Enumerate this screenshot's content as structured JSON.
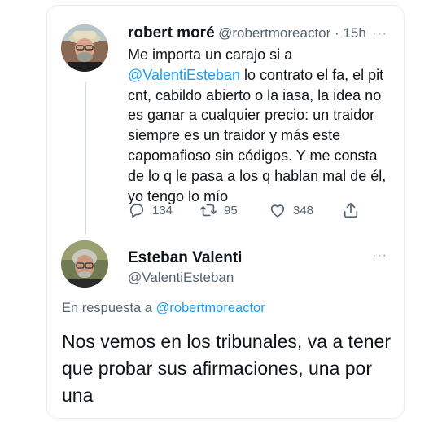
{
  "tweet1": {
    "name": "robert moré",
    "handle": "@robertmoreactor",
    "separator": " · ",
    "time": "15h",
    "text_before": "Me importa un carajo si a ",
    "mention": "@ValentiEsteban",
    "text_after": " lo contrato el fa, el pit cnt, cabildo abierto o la iasa, la idea no es ganar a cualquier precio: un traidor siempre es un traidor y más este capomafioso sin códigos. Y me consta de lo q le pasa a los q hablan mal de él, yo tengo lo mío",
    "replies": "134",
    "retweets": "95",
    "likes": "348",
    "more": "···"
  },
  "tweet2": {
    "name": "Esteban Valenti",
    "handle": "@ValentiEsteban",
    "reply_prefix": "En respuesta a ",
    "reply_mention": "@robertmoreactor",
    "text": "Nos vemos en los tribunales, va a tener que probar sus afirmaciones, una por una",
    "more": "···"
  },
  "colors": {
    "link": "#1d9bf0",
    "secondary": "#536471",
    "thread_line": "#cfd9de"
  }
}
